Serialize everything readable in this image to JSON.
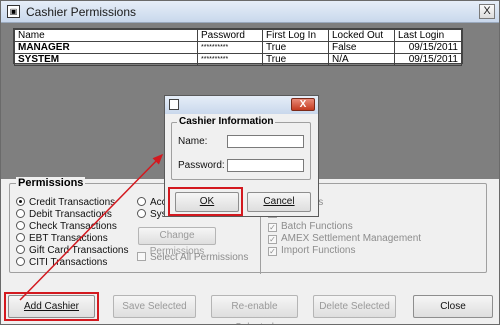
{
  "window": {
    "title": "Cashier Permissions",
    "close_glyph": "X"
  },
  "grid": {
    "columns": [
      "Name",
      "Password",
      "First Log In",
      "Locked Out",
      "Last Login"
    ],
    "rows": [
      {
        "name": "MANAGER",
        "password": "**********",
        "first_login": "True",
        "locked_out": "False",
        "last_login": "09/15/2011"
      },
      {
        "name": "SYSTEM",
        "password": "**********",
        "first_login": "True",
        "locked_out": "N/A",
        "last_login": "09/15/2011"
      }
    ]
  },
  "permissions": {
    "legend": "Permissions",
    "radio_left": [
      {
        "label": "Credit Transactions",
        "selected": true
      },
      {
        "label": "Debit Transactions",
        "selected": false
      },
      {
        "label": "Check Transactions",
        "selected": false
      },
      {
        "label": "EBT Transactions",
        "selected": false
      },
      {
        "label": "Gift Card Transactions",
        "selected": false
      },
      {
        "label": "CITI Transactions",
        "selected": false
      }
    ],
    "radio_mid": [
      {
        "label": "Acc",
        "selected": false
      },
      {
        "label": "Sys",
        "selected": false
      }
    ],
    "change_permissions_label": "Change Permissions",
    "select_all_label": "Select All Permissions",
    "right_checks": [
      {
        "label": "nsactions",
        "checked": false
      },
      {
        "label": "ctions",
        "checked": false
      },
      {
        "label": "Batch Functions",
        "checked": true
      },
      {
        "label": "AMEX Settlement Management",
        "checked": true
      },
      {
        "label": "Import Functions",
        "checked": true
      }
    ]
  },
  "buttons": {
    "add_cashier": "Add Cashier",
    "save_selected": "Save Selected",
    "reenable_selected": "Re-enable Selected",
    "delete_selected": "Delete Selected",
    "close": "Close"
  },
  "dialog": {
    "close_glyph": "X",
    "legend": "Cashier Information",
    "name_label": "Name:",
    "password_label": "Password:",
    "name_value": "",
    "password_value": "",
    "ok_label": "OK",
    "cancel_label": "Cancel"
  },
  "colors": {
    "annotation_red": "#d3191f"
  }
}
